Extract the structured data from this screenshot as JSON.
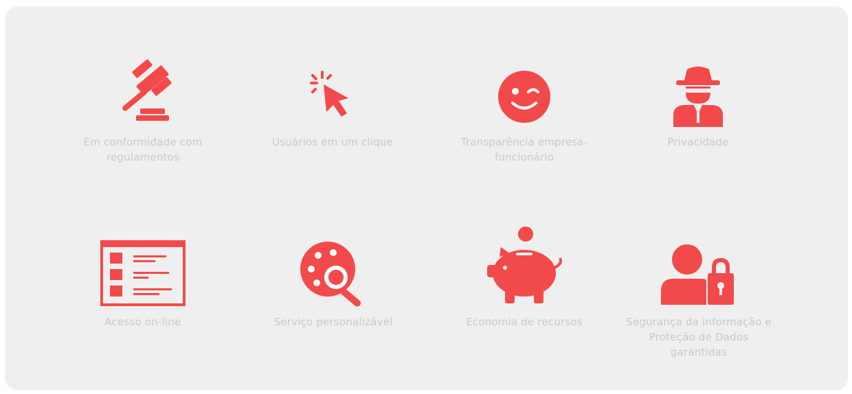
{
  "colors": {
    "accent": "#f24a4a",
    "panel_background": "#efefef",
    "label_text": "#c9c9c9"
  },
  "features": [
    {
      "label": "Em conformidade com regulamentos",
      "icon": "gavel-icon"
    },
    {
      "label": "Usuários em um clique",
      "icon": "cursor-click-icon"
    },
    {
      "label": "Transparência empresa-funcionário",
      "icon": "smile-wink-icon"
    },
    {
      "label": "Privacidade",
      "icon": "spy-agent-icon"
    },
    {
      "label": "Acesso on-line",
      "icon": "browser-window-icon"
    },
    {
      "label": "Serviço personalizável",
      "icon": "palette-search-icon"
    },
    {
      "label": "Economia de recursos",
      "icon": "piggy-bank-icon"
    },
    {
      "label": "Segurança da informação e Proteção de Dados garantidas",
      "icon": "user-lock-icon"
    }
  ]
}
